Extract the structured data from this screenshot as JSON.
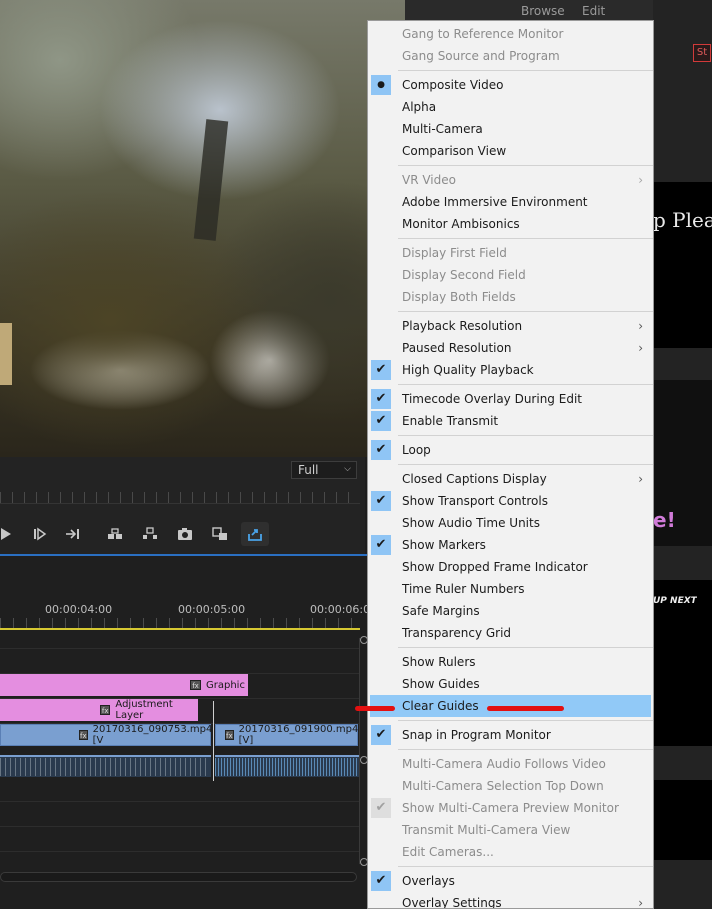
{
  "top_tabs": [
    "Browse",
    "Edit"
  ],
  "program_monitor": {
    "resolution_value": "Full"
  },
  "timeline": {
    "timecodes": [
      "00:00:04:00",
      "00:00:05:00",
      "00:00:06:0"
    ],
    "clips": {
      "graphic": "Graphic",
      "adjustment_layer": "Adjustment Layer",
      "video_1": "20170316_090753.mp4 [V",
      "video_2": "20170316_091900.mp4 [V]"
    }
  },
  "right_panel": {
    "badge": "St",
    "text_1": "p Pleas",
    "text_2": "e!",
    "text_3": "UP NEXT"
  },
  "menu": {
    "items": [
      {
        "label": "Gang to Reference Monitor",
        "state": "disabled"
      },
      {
        "label": "Gang Source and Program",
        "state": "disabled"
      },
      {
        "sep": true
      },
      {
        "label": "Composite Video",
        "mark": "dot"
      },
      {
        "label": "Alpha"
      },
      {
        "label": "Multi-Camera"
      },
      {
        "label": "Comparison View"
      },
      {
        "sep": true
      },
      {
        "label": "VR Video",
        "state": "disabled",
        "submenu": true
      },
      {
        "label": "Adobe Immersive Environment"
      },
      {
        "label": "Monitor Ambisonics"
      },
      {
        "sep": true
      },
      {
        "label": "Display First Field",
        "state": "disabled"
      },
      {
        "label": "Display Second Field",
        "state": "disabled"
      },
      {
        "label": "Display Both Fields",
        "state": "disabled"
      },
      {
        "sep": true
      },
      {
        "label": "Playback Resolution",
        "submenu": true
      },
      {
        "label": "Paused Resolution",
        "submenu": true
      },
      {
        "label": "High Quality Playback",
        "mark": "check"
      },
      {
        "sep": true
      },
      {
        "label": "Timecode Overlay During Edit",
        "mark": "check"
      },
      {
        "label": "Enable Transmit",
        "mark": "check"
      },
      {
        "sep": true
      },
      {
        "label": "Loop",
        "mark": "check"
      },
      {
        "sep": true
      },
      {
        "label": "Closed Captions Display",
        "submenu": true
      },
      {
        "label": "Show Transport Controls",
        "mark": "check"
      },
      {
        "label": "Show Audio Time Units"
      },
      {
        "label": "Show Markers",
        "mark": "check"
      },
      {
        "label": "Show Dropped Frame Indicator"
      },
      {
        "label": "Time Ruler Numbers"
      },
      {
        "label": "Safe Margins"
      },
      {
        "label": "Transparency Grid"
      },
      {
        "sep": true
      },
      {
        "label": "Show Rulers"
      },
      {
        "label": "Show Guides"
      },
      {
        "label": "Clear Guides",
        "highlighted": true
      },
      {
        "sep": true
      },
      {
        "label": "Snap in Program Monitor",
        "mark": "check"
      },
      {
        "sep": true
      },
      {
        "label": "Multi-Camera Audio Follows Video",
        "state": "disabled"
      },
      {
        "label": "Multi-Camera Selection Top Down",
        "state": "disabled"
      },
      {
        "label": "Show Multi-Camera Preview Monitor",
        "state": "disabled",
        "mark": "check-disabled"
      },
      {
        "label": "Transmit Multi-Camera View",
        "state": "disabled"
      },
      {
        "label": "Edit Cameras...",
        "state": "disabled"
      },
      {
        "sep": true
      },
      {
        "label": "Overlays",
        "mark": "check"
      },
      {
        "label": "Overlay Settings",
        "submenu": true
      }
    ]
  },
  "icons": {
    "check": "✔",
    "dot": "●",
    "submenu": "›"
  },
  "colors": {
    "menu_bg": "#f2f2f2",
    "highlight": "#91c9f7",
    "check_bg": "#8fc5f5",
    "annotation_red": "#e31010",
    "clip_pink": "#e48ee0",
    "clip_blue": "#7a9fd0",
    "timeline_accent": "#2a6fc2"
  }
}
